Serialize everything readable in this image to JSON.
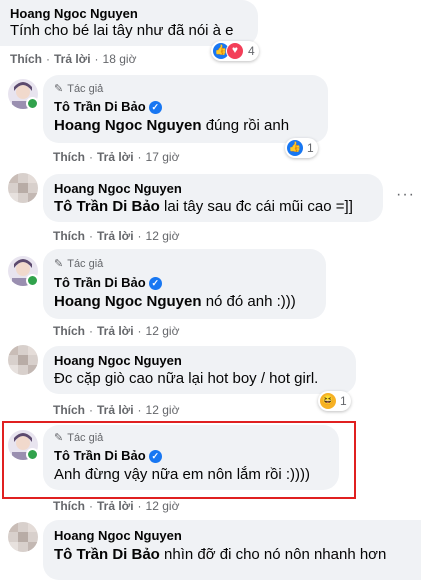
{
  "comments": [
    {
      "name": "Hoang Ngoc Nguyen",
      "text": "Tính cho bé lai tây như đã nói à e",
      "action_like": "Thích",
      "action_reply": "Trả lời",
      "time": "18 giờ",
      "reaction_count": "4"
    },
    {
      "author_badge": "Tác giả",
      "name": "Tô Trần Di Bảo",
      "tag": "Hoang Ngoc Nguyen",
      "text": "đúng rồi anh",
      "action_like": "Thích",
      "action_reply": "Trả lời",
      "time": "17 giờ",
      "reaction_count": "1"
    },
    {
      "name": "Hoang Ngoc Nguyen",
      "tag": "Tô Trần Di Bảo",
      "text": "lai tây sau đc cái mũi cao =]]",
      "action_like": "Thích",
      "action_reply": "Trả lời",
      "time": "12 giờ",
      "more": "···"
    },
    {
      "author_badge": "Tác giả",
      "name": "Tô Trần Di Bảo",
      "tag": "Hoang Ngoc Nguyen",
      "text": "nó đó anh :)))",
      "action_like": "Thích",
      "action_reply": "Trả lời",
      "time": "12 giờ"
    },
    {
      "name": "Hoang Ngoc Nguyen",
      "text": "Đc cặp giò cao nữa lại hot boy / hot girl.",
      "action_like": "Thích",
      "action_reply": "Trả lời",
      "time": "12 giờ",
      "reaction_count": "1"
    },
    {
      "author_badge": "Tác giả",
      "name": "Tô Trần Di Bảo",
      "text": "Anh đừng vậy nữa em nôn lắm rồi :))))",
      "action_like": "Thích",
      "action_reply": "Trả lời",
      "time": "12 giờ"
    },
    {
      "name": "Hoang Ngoc Nguyen",
      "tag": "Tô Trần Di Bảo",
      "text": "nhìn đỡ đi cho nó nôn nhanh hơn"
    }
  ],
  "colors": {
    "bubble": "#f0f2f5",
    "verified": "#1877f2",
    "highlight": "#e02020",
    "online": "#31a24c"
  }
}
